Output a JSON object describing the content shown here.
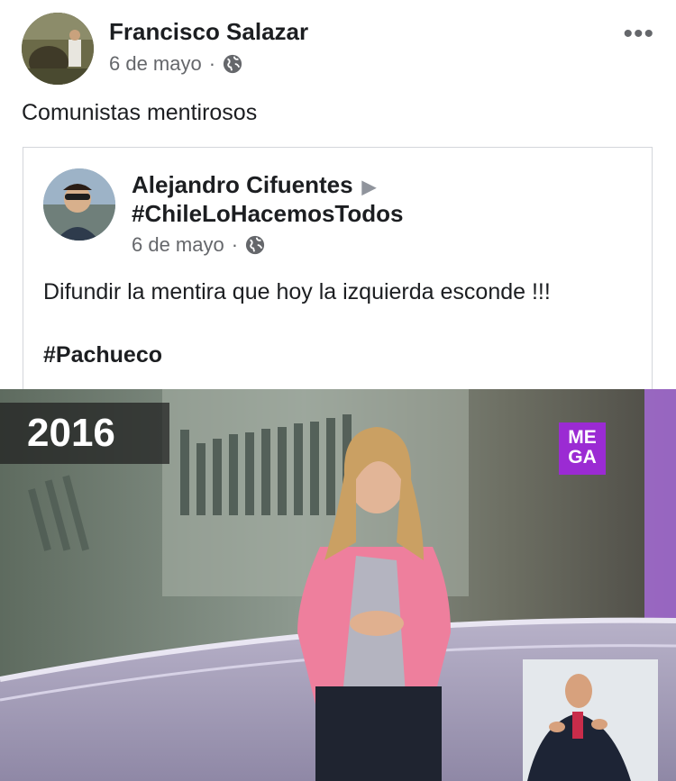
{
  "post": {
    "author": "Francisco Salazar",
    "date": "6 de mayo",
    "separator": "·",
    "privacy_icon": "globe-icon",
    "more_label": "•••",
    "text": "Comunistas mentirosos"
  },
  "shared": {
    "author": "Alejandro Cifuentes",
    "arrow": "▶",
    "tag": "#ChileLoHacemosTodos",
    "date": "6 de mayo",
    "separator": "·",
    "privacy_icon": "globe-icon",
    "text": "Difundir la mentira que hoy la izquierda esconde !!!",
    "hashtag": "#Pachueco"
  },
  "video": {
    "year_label": "2016",
    "channel_logo_line1": "ME",
    "channel_logo_line2": "GA",
    "logo_color": "#9b2bd3"
  },
  "colors": {
    "text": "#1c1e21",
    "secondary": "#65676b",
    "border": "#d3d6db"
  }
}
